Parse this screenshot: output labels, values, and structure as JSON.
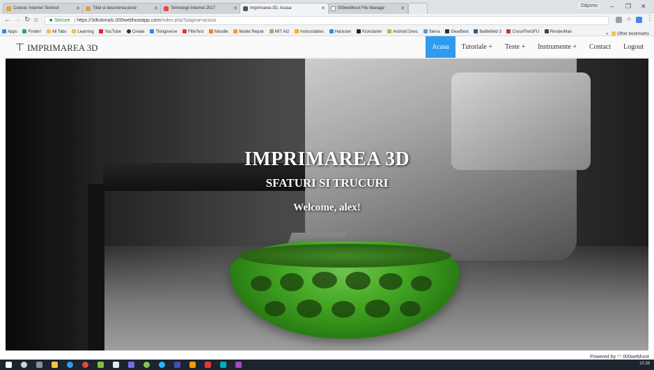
{
  "browser": {
    "tabs": [
      {
        "label": "Course: Internet Technol",
        "active": false
      },
      {
        "label": "Titlul și descrierea proie",
        "active": false
      },
      {
        "label": "Tehnologii Internet 2017",
        "active": false
      },
      {
        "label": "Imprimarea 3D. Acasa",
        "active": true
      },
      {
        "label": "000webhost File Manage",
        "active": false
      }
    ],
    "profile": "Dǎjomo",
    "url_secure": "Secure",
    "url_host": "https://3dtutorials.000webhostapp.com",
    "url_path": "/index.php?pagina=acasa",
    "bookmarks": [
      {
        "label": "Apps",
        "color": "#4285f4"
      },
      {
        "label": "Finder!",
        "color": "#34a853"
      },
      {
        "label": "All Tabs",
        "color": "#f4c542"
      },
      {
        "label": "Learning",
        "color": "#f4c542"
      },
      {
        "label": "YouTube",
        "color": "#e62117"
      },
      {
        "label": "Create",
        "color": "#333333"
      },
      {
        "label": "Thingiverse",
        "color": "#248bfb"
      },
      {
        "label": "FliteTest",
        "color": "#e03c31"
      },
      {
        "label": "Moodle",
        "color": "#f98012"
      },
      {
        "label": "Model Repair",
        "color": "#f4a300"
      },
      {
        "label": "MIT AI2",
        "color": "#8bc34a"
      },
      {
        "label": "Instructables",
        "color": "#f7b500"
      },
      {
        "label": "Hackster",
        "color": "#1e9bd7"
      },
      {
        "label": "Kickstarter",
        "color": "#2bde73"
      },
      {
        "label": "Android Devs",
        "color": "#a4c639"
      },
      {
        "label": "Sierra",
        "color": "#5b9bd5"
      },
      {
        "label": "GearBest",
        "color": "#333333"
      },
      {
        "label": "Battlefield 3",
        "color": "#2b5b84"
      },
      {
        "label": "CrossFireGFU",
        "color": "#c0392b"
      },
      {
        "label": "RenderMan",
        "color": "#444444"
      }
    ],
    "bookmarks_more": "»",
    "other_bookmarks": "Other bookmarks"
  },
  "site": {
    "brand": "IMPRIMAREA 3D",
    "nav": [
      {
        "label": "Acasa",
        "active": true
      },
      {
        "label": "Tutoriale +",
        "active": false
      },
      {
        "label": "Teste +",
        "active": false
      },
      {
        "label": "Instrumente +",
        "active": false
      },
      {
        "label": "Contact",
        "active": false
      },
      {
        "label": "Logout",
        "active": false
      }
    ],
    "accent_color": "#2f9bef"
  },
  "hero": {
    "title": "IMPRIMAREA 3D",
    "subtitle": "SFATURI SI TRUCURI",
    "welcome": "Welcome, alex!"
  },
  "footer": {
    "powered_prefix": "Powered by",
    "powered_brand": "000webhost"
  },
  "taskbar": {
    "clock": "15:38"
  }
}
